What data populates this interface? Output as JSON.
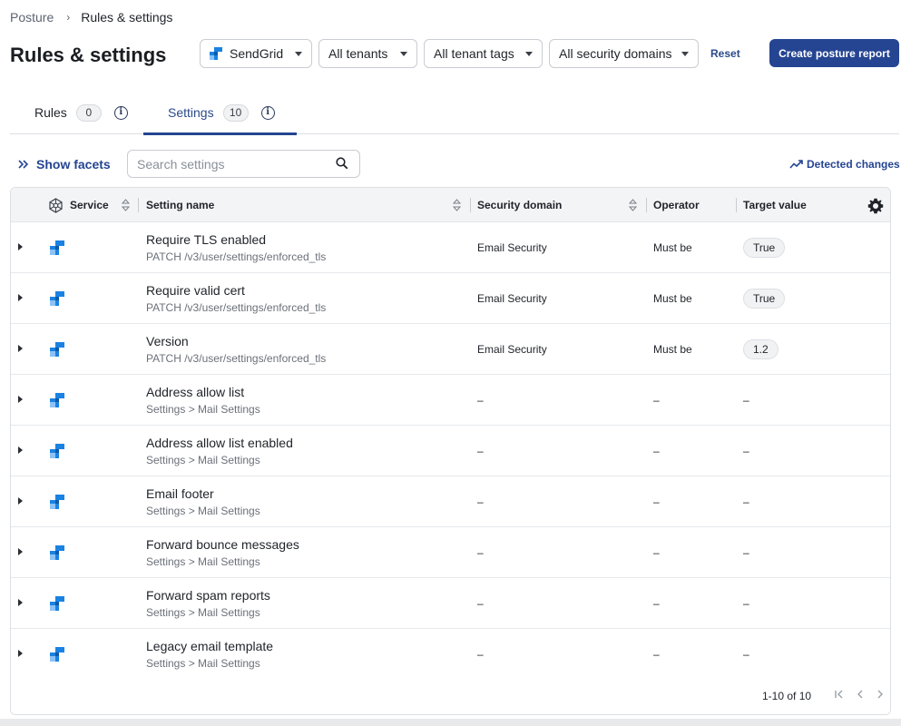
{
  "breadcrumb": {
    "parent": "Posture",
    "separator": "›",
    "current": "Rules & settings"
  },
  "page_title": "Rules & settings",
  "filters": {
    "service": "SendGrid",
    "tenants": "All tenants",
    "tenant_tags": "All tenant tags",
    "security_domains": "All security domains",
    "reset": "Reset"
  },
  "actions": {
    "create_report": "Create posture report"
  },
  "tabs": [
    {
      "label": "Rules",
      "count": "0"
    },
    {
      "label": "Settings",
      "count": "10"
    }
  ],
  "toolbar": {
    "show_facets": "Show facets",
    "search_placeholder": "Search settings",
    "detected_changes": "Detected changes"
  },
  "table": {
    "columns": [
      "Service",
      "Setting name",
      "Security domain",
      "Operator",
      "Target value"
    ],
    "rows": [
      {
        "name": "Require TLS enabled",
        "sub": "PATCH /v3/user/settings/enforced_tls",
        "domain": "Email Security",
        "operator": "Must be",
        "target": "True"
      },
      {
        "name": "Require valid cert",
        "sub": "PATCH /v3/user/settings/enforced_tls",
        "domain": "Email Security",
        "operator": "Must be",
        "target": "True"
      },
      {
        "name": "Version",
        "sub": "PATCH /v3/user/settings/enforced_tls",
        "domain": "Email Security",
        "operator": "Must be",
        "target": "1.2"
      },
      {
        "name": "Address allow list",
        "sub": "Settings > Mail Settings",
        "domain": "–",
        "operator": "–",
        "target": "–"
      },
      {
        "name": "Address allow list enabled",
        "sub": "Settings > Mail Settings",
        "domain": "–",
        "operator": "–",
        "target": "–"
      },
      {
        "name": "Email footer",
        "sub": "Settings > Mail Settings",
        "domain": "–",
        "operator": "–",
        "target": "–"
      },
      {
        "name": "Forward bounce messages",
        "sub": "Settings > Mail Settings",
        "domain": "–",
        "operator": "–",
        "target": "–"
      },
      {
        "name": "Forward spam reports",
        "sub": "Settings > Mail Settings",
        "domain": "–",
        "operator": "–",
        "target": "–"
      },
      {
        "name": "Legacy email template",
        "sub": "Settings > Mail Settings",
        "domain": "–",
        "operator": "–",
        "target": "–"
      }
    ]
  },
  "pagination": {
    "summary": "1-10 of 10"
  },
  "colors": {
    "primary": "#254592",
    "link": "#2b4a8a",
    "service_logo": "#1a82e2"
  },
  "icons": [
    "chevron-right-icon",
    "sendgrid-logo-icon",
    "caret-down-icon",
    "info-icon",
    "double-chevron-right-icon",
    "search-icon",
    "trend-line-icon",
    "network-icon",
    "sort-icon",
    "gear-icon",
    "first-page-icon",
    "prev-page-icon",
    "next-page-icon"
  ]
}
